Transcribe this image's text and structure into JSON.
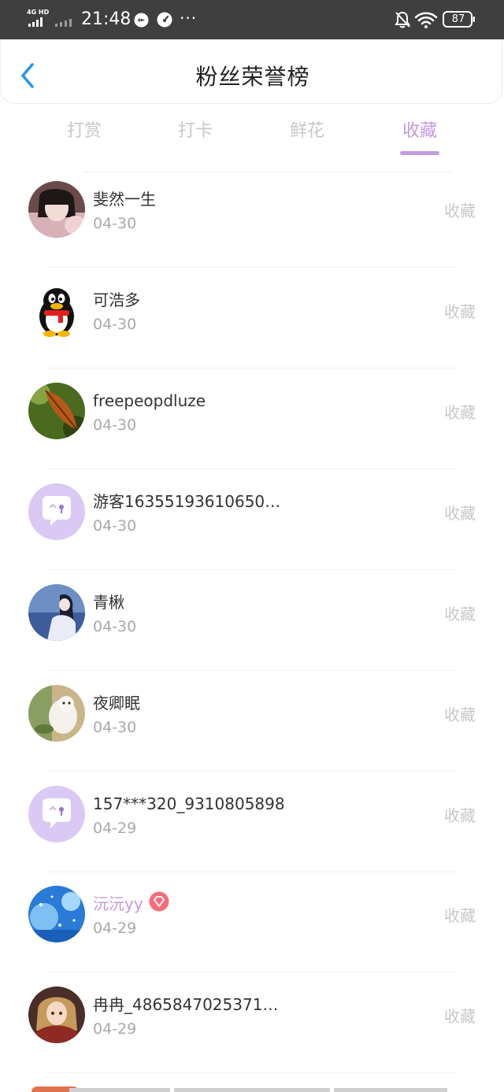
{
  "status_bar": {
    "network": "4G HD",
    "time": "21:48",
    "more": "···",
    "battery": "87"
  },
  "header": {
    "title": "粉丝荣誉榜"
  },
  "tabs": [
    {
      "label": "打赏",
      "active": false
    },
    {
      "label": "打卡",
      "active": false
    },
    {
      "label": "鲜花",
      "active": false
    },
    {
      "label": "收藏",
      "active": true
    }
  ],
  "colors": {
    "accent": "#c49ae0",
    "status_bar": "#3f3f3f",
    "header_back_icon": "#2196f3"
  },
  "list": [
    {
      "name": "斐然一生",
      "date": "04-30",
      "action": "收藏",
      "avatar": "photo-girl"
    },
    {
      "name": "可浩多",
      "date": "04-30",
      "action": "收藏",
      "avatar": "penguin"
    },
    {
      "name": "freepeopdluze",
      "date": "04-30",
      "action": "收藏",
      "avatar": "leaf"
    },
    {
      "name": "游客16355193610650…",
      "date": "04-30",
      "action": "收藏",
      "avatar": "default-chat"
    },
    {
      "name": "青楸",
      "date": "04-30",
      "action": "收藏",
      "avatar": "photo-blue"
    },
    {
      "name": "夜卿眠",
      "date": "04-30",
      "action": "收藏",
      "avatar": "photo-cat"
    },
    {
      "name": "157***320_9310805898",
      "date": "04-29",
      "action": "收藏",
      "avatar": "default-chat"
    },
    {
      "name": "沅沅yy",
      "date": "04-29",
      "action": "收藏",
      "avatar": "photo-sky",
      "vip": true
    },
    {
      "name": "冉冉_4865847025371…",
      "date": "04-29",
      "action": "收藏",
      "avatar": "photo-anime"
    }
  ]
}
